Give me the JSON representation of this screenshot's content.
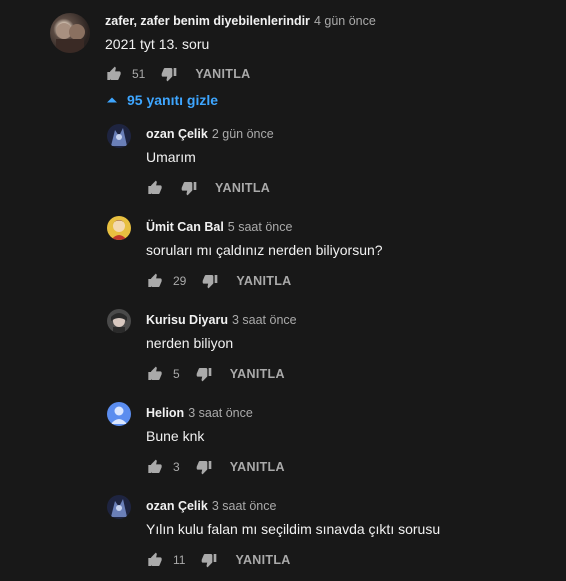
{
  "top_comment": {
    "author": "zafer, zafer benim diyebilenlerindir",
    "time": "4 gün önce",
    "text": "2021 tyt 13. soru",
    "likes": "51",
    "reply_label": "YANITLA"
  },
  "replies_toggle": {
    "label": "95 yanıtı gizle"
  },
  "replies": [
    {
      "author": "ozan Çelik",
      "time": "2 gün önce",
      "text": "Umarım",
      "likes": "",
      "reply_label": "YANITLA"
    },
    {
      "author": "Ümit Can Bal",
      "time": "5 saat önce",
      "text": "soruları mı çaldınız nerden biliyorsun?",
      "likes": "29",
      "reply_label": "YANITLA"
    },
    {
      "author": "Kurisu Diyaru",
      "time": "3 saat önce",
      "text": "nerden biliyon",
      "likes": "5",
      "reply_label": "YANITLA"
    },
    {
      "author": "Helion",
      "time": "3 saat önce",
      "text": "Bune knk",
      "likes": "3",
      "reply_label": "YANITLA"
    },
    {
      "author": "ozan Çelik",
      "time": "3 saat önce",
      "text": "Yılın kulu falan mı seçildim sınavda çıktı sorusu",
      "likes": "11",
      "reply_label": "YANITLA"
    }
  ],
  "colors": {
    "background": "#181818",
    "link": "#3ea6ff",
    "muted": "#aaaaaa"
  },
  "icons": [
    "thumb-up-icon",
    "thumb-down-icon",
    "chevron-up-icon"
  ]
}
